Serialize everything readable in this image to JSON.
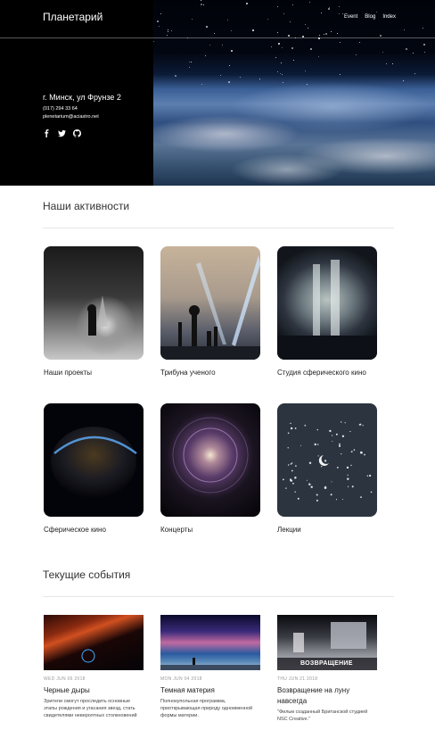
{
  "header": {
    "site_title": "Планетарий",
    "nav": [
      "Event",
      "Blog",
      "Index"
    ],
    "address": "г. Минск, ул Фрунзе 2",
    "phone": "(017) 294 33 64",
    "email": "plenetarium@aciastro.net",
    "socials": [
      "facebook-icon",
      "twitter-icon",
      "github-icon"
    ]
  },
  "activities": {
    "title": "Наши активности",
    "items": [
      {
        "label": "Наши проекты"
      },
      {
        "label": "Трибуна ученого"
      },
      {
        "label": "Студия сферического кино"
      },
      {
        "label": "Сферическое кино"
      },
      {
        "label": "Концерты"
      },
      {
        "label": "Лекции"
      }
    ]
  },
  "events": {
    "title": "Текущие события",
    "items": [
      {
        "date": "WED JUN 06 2018",
        "title": "Черные дыры",
        "desc": "Зрители смогут проследить основные этапы рождения и угасания звезд, стать свидетелями невероятных столкновений"
      },
      {
        "date": "MON JUN 04 2018",
        "title": "Темная материя",
        "desc": "Полнокупольная программа, приоткрывающая природу одноименной формы материи."
      },
      {
        "date": "THU JUN 21 2018",
        "title": "Возвращение на луну навсегда",
        "desc": "\"Фильм созданный Британской студией NSC Creative.\"",
        "thumb_caption": "ВОЗВРАЩЕНИЕ"
      }
    ]
  },
  "colors": {
    "accent": "#000000",
    "text": "#222222",
    "muted": "#999999"
  }
}
